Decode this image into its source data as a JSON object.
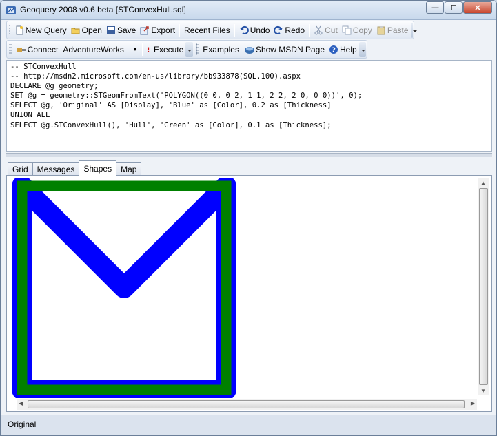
{
  "window": {
    "title": "Geoquery 2008 v0.6 beta [STConvexHull.sql]",
    "controls": {
      "minimize": "—",
      "maximize": "☐",
      "close": "✕"
    }
  },
  "toolbar1": {
    "new_query": "New Query",
    "open": "Open",
    "save": "Save",
    "export": "Export",
    "recent_files": "Recent Files",
    "undo": "Undo",
    "redo": "Redo",
    "cut": "Cut",
    "copy": "Copy",
    "paste": "Paste"
  },
  "toolbar2": {
    "connect": "Connect",
    "database": "AdventureWorks",
    "execute": "Execute",
    "examples": "Examples",
    "show_msdn": "Show MSDN Page",
    "help": "Help"
  },
  "editor": {
    "lines": [
      "-- STConvexHull",
      "-- http://msdn2.microsoft.com/en-us/library/bb933878(SQL.100).aspx",
      "DECLARE @g geometry;",
      "SET @g = geometry::STGeomFromText('POLYGON((0 0, 0 2, 1 1, 2 2, 2 0, 0 0))', 0);",
      "SELECT @g, 'Original' AS [Display], 'Blue' as [Color], 0.2 as [Thickness]",
      "UNION ALL",
      "SELECT @g.STConvexHull(), 'Hull', 'Green' as [Color], 0.1 as [Thickness];"
    ]
  },
  "tabs": [
    "Grid",
    "Messages",
    "Shapes",
    "Map"
  ],
  "active_tab": "Shapes",
  "shapes": {
    "original_color": "#0000ff",
    "hull_color": "#008000",
    "original_points": [
      [
        0,
        0
      ],
      [
        0,
        2
      ],
      [
        1,
        1
      ],
      [
        2,
        2
      ],
      [
        2,
        0
      ],
      [
        0,
        0
      ]
    ],
    "hull_points": [
      [
        0,
        0
      ],
      [
        0,
        2
      ],
      [
        2,
        2
      ],
      [
        2,
        0
      ],
      [
        0,
        0
      ]
    ]
  },
  "colors": {
    "blue": "#0000ff",
    "green": "#008000"
  },
  "status": {
    "text": "Original"
  }
}
